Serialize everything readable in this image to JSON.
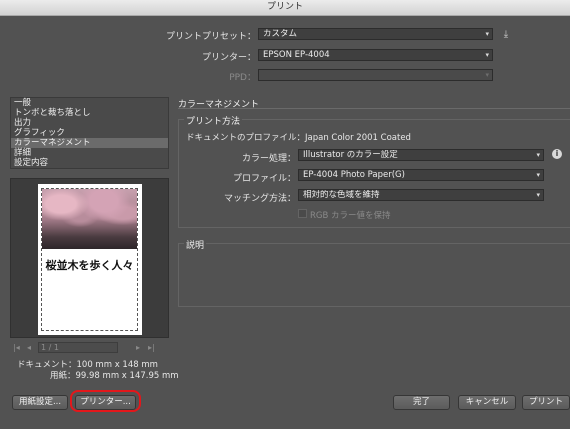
{
  "window": {
    "title": "プリント"
  },
  "preset": {
    "label": "プリントプリセット：",
    "value": "カスタム"
  },
  "printer": {
    "label": "プリンター：",
    "value": "EPSON EP-4004"
  },
  "ppd": {
    "label": "PPD：",
    "value": ""
  },
  "sidebar": {
    "items": [
      {
        "label": "一般"
      },
      {
        "label": "トンボと裁ち落とし"
      },
      {
        "label": "出力"
      },
      {
        "label": "グラフィック"
      },
      {
        "label": "カラーマネジメント"
      },
      {
        "label": "詳細"
      },
      {
        "label": "設定内容"
      }
    ],
    "selected_index": 4
  },
  "preview": {
    "caption": "桜並木を歩く人々",
    "page_indicator": "1 / 1",
    "document_label": "ドキュメント：100 mm x 148 mm",
    "paper_label": "用紙：99.98 mm x 147.95 mm"
  },
  "color_management": {
    "section_title": "カラーマネジメント",
    "print_method_title": "プリント方法",
    "document_profile": "ドキュメントのプロファイル：Japan Color 2001 Coated",
    "color_handling": {
      "label": "カラー処理：",
      "value": "Illustrator のカラー設定"
    },
    "printer_profile": {
      "label": "プロファイル：",
      "value": "EP-4004 Photo Paper(G)"
    },
    "matching_method": {
      "label": "マッチング方法：",
      "value": "相対的な色域を維持"
    },
    "preserve_rgb": {
      "label": "RGB カラー値を保持",
      "checked": false,
      "enabled": false
    },
    "description_title": "説明"
  },
  "buttons": {
    "page_setup": "用紙設定...",
    "printer": "プリンター...",
    "done": "完了",
    "cancel": "キャンセル",
    "print": "プリント"
  },
  "colors": {
    "highlight": "#e3171b",
    "background": "#525252"
  },
  "icons": {
    "save_preset": "save-preset-icon",
    "info": "info-icon",
    "dropdown": "chevron-down-icon"
  }
}
